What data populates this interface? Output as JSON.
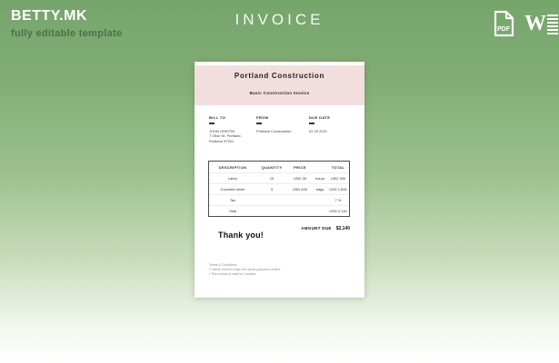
{
  "header": {
    "brand": "BETTY.MK",
    "tagline": "fully editable template",
    "title": "INVOICE",
    "pdf_icon_label": "PDF"
  },
  "colors": {
    "background_green": "#76a56c",
    "band_pink": "#f2dedd",
    "text_white": "#ffffff"
  },
  "invoice": {
    "company": "Portland Construction",
    "subtitle": "Basic Construction Invoice",
    "bill_to": {
      "label": "BILL TO",
      "lines": [
        "JOHN GRIFFIN",
        "7 Olive St. Portland,",
        "Portland 97201"
      ]
    },
    "from": {
      "label": "FROM",
      "value": "Portland Construction"
    },
    "due_date": {
      "label": "DUE DATE",
      "value": "02 20 2021"
    },
    "table": {
      "headers": [
        "DESCRIPTION",
        "QUANTITY",
        "PRICE",
        "TOTAL"
      ],
      "rows": [
        {
          "description": "Labor",
          "quantity": "10",
          "price": "USD 35",
          "unit": "hours",
          "total": "USD 350"
        },
        {
          "description": "Concrete mixer",
          "quantity": "3",
          "price": "USD 600",
          "unit": "bags",
          "total": "USD 1,800"
        },
        {
          "description": "Tax",
          "quantity": "",
          "price": "",
          "unit": "",
          "total": "7 %"
        },
        {
          "description": "Total",
          "quantity": "",
          "price": "",
          "unit": "",
          "total": "USD 2,140"
        }
      ]
    },
    "amount_due_label": "AMOUNT DUE",
    "amount_due_value": "$2,140",
    "thank_you": "Thank you!",
    "terms": {
      "heading": "Terms & Conditions",
      "items": [
        "Clients need to make the above payment on time.",
        "This invoice is valid for 2 weeks."
      ]
    }
  }
}
